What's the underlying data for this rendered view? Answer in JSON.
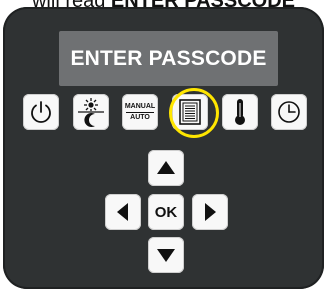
{
  "caption": {
    "prefix": "will read ",
    "emphasis": "ENTER PASSCODE"
  },
  "display": {
    "text": "ENTER PASSCODE"
  },
  "keys": {
    "manual_auto": {
      "top": "MANUAL",
      "bottom": "AUTO"
    },
    "ok": "OK"
  },
  "icons": [
    "power-icon",
    "day-night-icon",
    "manual-auto-icon",
    "menu-list-icon",
    "thermometer-icon",
    "clock-icon",
    "arrow-up-icon",
    "arrow-left-icon",
    "arrow-right-icon",
    "arrow-down-icon"
  ],
  "colors": {
    "panel": "#2f3233",
    "display": "#6f7173",
    "highlight": "#ffe600",
    "key": "#f8f8f8"
  }
}
